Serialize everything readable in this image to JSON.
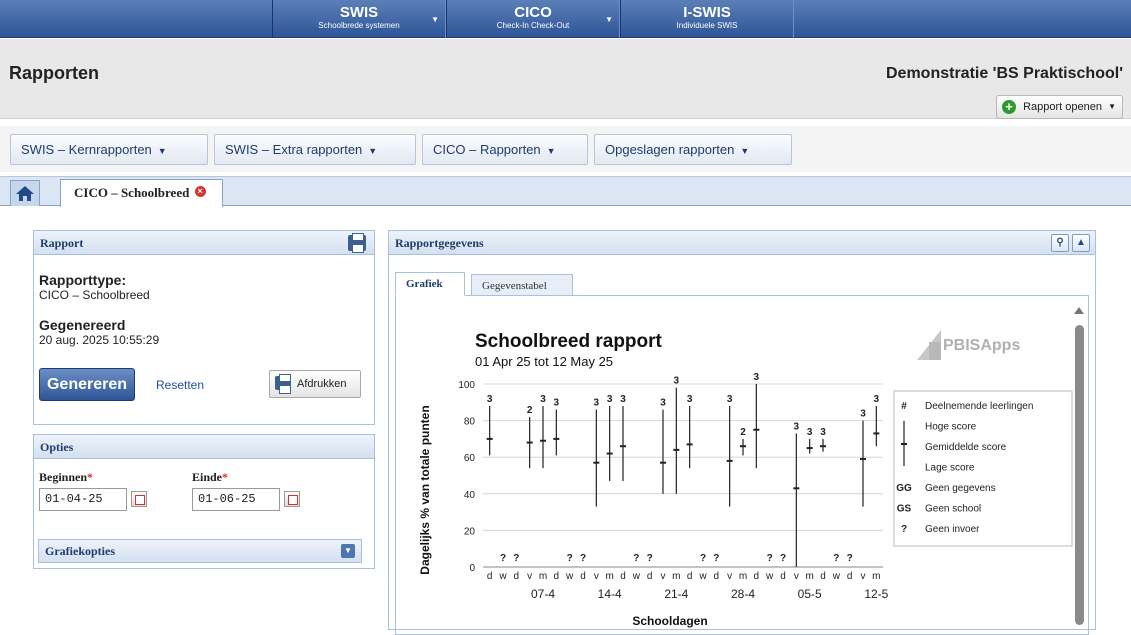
{
  "nav": {
    "tabs": [
      {
        "title": "SWIS",
        "subtitle": "Schoolbrede systemen"
      },
      {
        "title": "CICO",
        "subtitle": "Check-In Check-Out"
      },
      {
        "title": "I-SWIS",
        "subtitle": "Individuele SWIS"
      }
    ]
  },
  "header": {
    "title": "Rapporten",
    "school": "Demonstratie 'BS Praktischool'",
    "open_report": "Rapport openen"
  },
  "menu": {
    "items": [
      "SWIS – Kernrapporten",
      "SWIS – Extra rapporten",
      "CICO – Rapporten",
      "Opgeslagen rapporten"
    ]
  },
  "tabs": {
    "active": "CICO – Schoolbreed"
  },
  "report_panel": {
    "title": "Rapport",
    "type_label": "Rapporttype:",
    "type_value": "CICO – Schoolbreed",
    "gen_label": "Gegenereerd",
    "gen_value": "20 aug. 2025 10:55:29",
    "generate": "Genereren",
    "reset": "Resetten",
    "print": "Afdrukken"
  },
  "options_panel": {
    "title": "Opties",
    "start_label": "Beginnen",
    "start_value": "01-04-25",
    "end_label": "Einde",
    "end_value": "01-06-25",
    "graph_options": "Grafiekopties"
  },
  "data_panel": {
    "title": "Rapportgegevens",
    "tab_chart": "Grafiek",
    "tab_table": "Gegevenstabel"
  },
  "chart_data": {
    "type": "scatter",
    "title": "Schoolbreed rapport",
    "subtitle": "01 Apr 25 tot 12 May 25",
    "logo": "PBISApps",
    "ylabel": "Dagelijks % van totale punten",
    "xlabel": "Schooldagen",
    "ylim": [
      0,
      100
    ],
    "yticks": [
      0,
      20,
      40,
      60,
      80,
      100
    ],
    "grid": true,
    "day_labels": [
      "d",
      "w",
      "d",
      "v",
      "m",
      "d",
      "w",
      "d",
      "v",
      "m",
      "d",
      "w",
      "d",
      "v",
      "m",
      "d",
      "w",
      "d",
      "v",
      "m",
      "d",
      "w",
      "d",
      "v",
      "m",
      "d",
      "w",
      "d",
      "v",
      "m"
    ],
    "week_labels": [
      {
        "label": "07-4",
        "day": 4
      },
      {
        "label": "14-4",
        "day": 9
      },
      {
        "label": "21-4",
        "day": 14
      },
      {
        "label": "28-4",
        "day": 19
      },
      {
        "label": "05-5",
        "day": 24
      },
      {
        "label": "12-5",
        "day": 29
      }
    ],
    "days": [
      {
        "n": "3",
        "mean": 70,
        "low": 61,
        "high": 88
      },
      {
        "n": "?"
      },
      {
        "n": "?"
      },
      {
        "n": "2",
        "mean": 68,
        "low": 54,
        "high": 82
      },
      {
        "n": "3",
        "mean": 69,
        "low": 54,
        "high": 88
      },
      {
        "n": "3",
        "mean": 70,
        "low": 61,
        "high": 86
      },
      {
        "n": "?"
      },
      {
        "n": "?"
      },
      {
        "n": "3",
        "mean": 57,
        "low": 33,
        "high": 86
      },
      {
        "n": "3",
        "mean": 62,
        "low": 47,
        "high": 88
      },
      {
        "n": "3",
        "mean": 66,
        "low": 47,
        "high": 88
      },
      {
        "n": "?"
      },
      {
        "n": "?"
      },
      {
        "n": "3",
        "mean": 57,
        "low": 40,
        "high": 86
      },
      {
        "n": "3",
        "mean": 64,
        "low": 40,
        "high": 98
      },
      {
        "n": "3",
        "mean": 67,
        "low": 54,
        "high": 88
      },
      {
        "n": "?"
      },
      {
        "n": "?"
      },
      {
        "n": "3",
        "mean": 58,
        "low": 33,
        "high": 88
      },
      {
        "n": "2",
        "mean": 66,
        "low": 61,
        "high": 70
      },
      {
        "n": "3",
        "mean": 75,
        "low": 54,
        "high": 100
      },
      {
        "n": "?"
      },
      {
        "n": "?"
      },
      {
        "n": "3",
        "mean": 43,
        "low": 0,
        "high": 73
      },
      {
        "n": "3",
        "mean": 65,
        "low": 62,
        "high": 70
      },
      {
        "n": "3",
        "mean": 66,
        "low": 63,
        "high": 70
      },
      {
        "n": "?"
      },
      {
        "n": "?"
      },
      {
        "n": "3",
        "mean": 59,
        "low": 33,
        "high": 80
      },
      {
        "n": "3",
        "mean": 73,
        "low": 66,
        "high": 88
      }
    ],
    "legend": [
      {
        "sym": "#",
        "text": "Deelnemende leerlingen"
      },
      {
        "sym": "",
        "text": "Hoge score"
      },
      {
        "sym": "",
        "text": "Gemiddelde score"
      },
      {
        "sym": "",
        "text": "Lage score"
      },
      {
        "sym": "GG",
        "text": "Geen gegevens"
      },
      {
        "sym": "GS",
        "text": "Geen school"
      },
      {
        "sym": "?",
        "text": "Geen invoer"
      }
    ]
  }
}
